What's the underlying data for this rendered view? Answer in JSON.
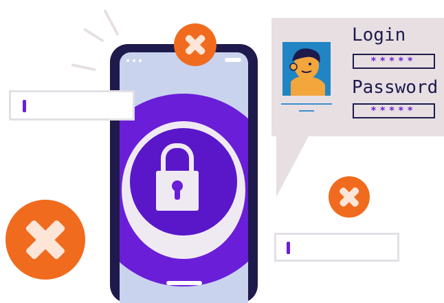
{
  "login_card": {
    "login_label": "Login",
    "login_mask": "*****",
    "password_label": "Password",
    "password_mask": "*****"
  },
  "icons": {
    "close_badges": [
      "close-icon",
      "close-icon",
      "close-icon"
    ],
    "lock": "lock-icon",
    "avatar": "user-avatar-icon"
  },
  "colors": {
    "accent_purple": "#6a1ed8",
    "deep_purple": "#5a17c9",
    "alert_orange": "#f06b1e",
    "phone_navy": "#1e1a4c",
    "screen_blue": "#c9d3ee",
    "card_gray": "#e7dfe2",
    "avatar_blue": "#2185c4",
    "avatar_skin": "#f2a63c"
  }
}
